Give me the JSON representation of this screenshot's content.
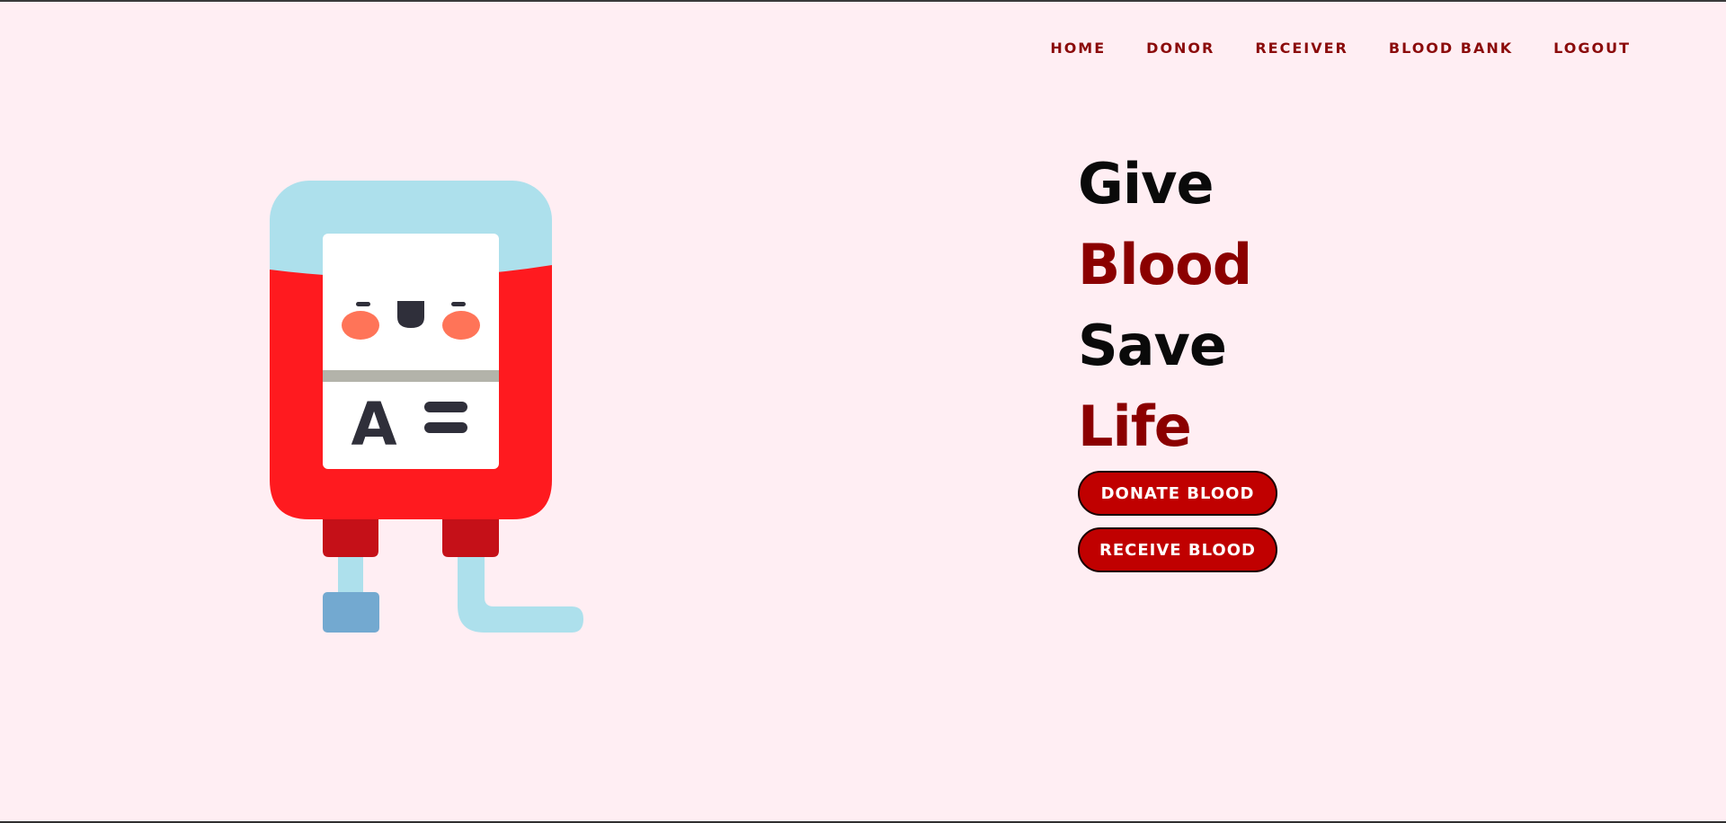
{
  "nav": {
    "items": [
      {
        "label": "HOME"
      },
      {
        "label": "DONOR"
      },
      {
        "label": "RECEIVER"
      },
      {
        "label": "BLOOD BANK"
      },
      {
        "label": "LOGOUT"
      }
    ]
  },
  "hero": {
    "words": [
      "Give",
      "Blood",
      "Save",
      "Life"
    ]
  },
  "buttons": {
    "donate_label": "DONATE BLOOD",
    "receive_label": "RECEIVE BLOOD"
  },
  "illustration": {
    "icon": "blood-bag-icon",
    "bag_label": "A"
  },
  "colors": {
    "background": "#FFEEF3",
    "nav_text": "#8B0B0B",
    "accent_red": "#8B0000",
    "button_fill": "#C00000",
    "bag_red": "#FF1A1F",
    "bag_top": "#ADE0EC",
    "tube": "#ADE0EC",
    "connector": "#73A9D0"
  }
}
